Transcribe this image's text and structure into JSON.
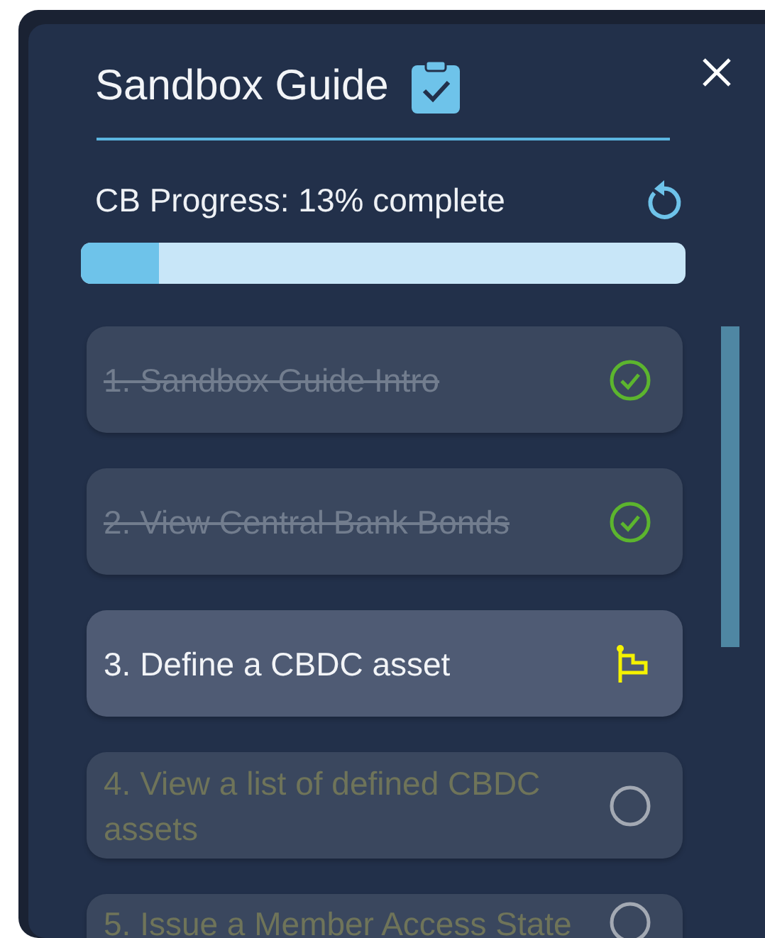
{
  "title": "Sandbox Guide",
  "progress": {
    "label": "CB Progress: 13% complete",
    "level": 0.13
  },
  "steps": [
    {
      "label": "1. Sandbox Guide Intro",
      "kind": "done"
    },
    {
      "label": "2. View Central Bank Bonds",
      "kind": "done"
    },
    {
      "label": "3. Define a CBDC asset",
      "kind": "current"
    },
    {
      "label": "4. View a list of defined CBDC assets",
      "kind": "todo"
    },
    {
      "label": "5. Issue a Member Access State",
      "kind": "todo"
    }
  ]
}
